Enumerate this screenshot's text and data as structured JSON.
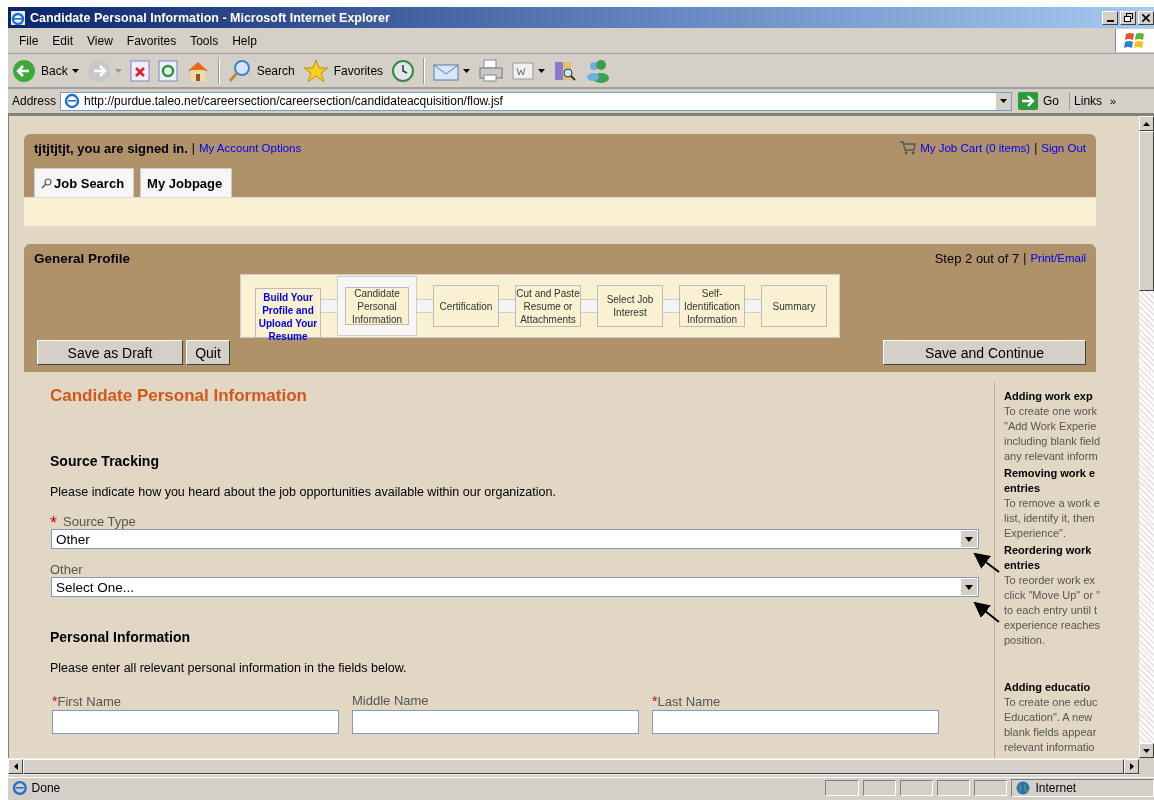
{
  "window": {
    "title": "Candidate Personal Information - Microsoft Internet Explorer"
  },
  "menu": [
    "File",
    "Edit",
    "View",
    "Favorites",
    "Tools",
    "Help"
  ],
  "toolbar": {
    "back": "Back",
    "search": "Search",
    "favorites": "Favorites"
  },
  "address": {
    "label": "Address",
    "url": "http://purdue.taleo.net/careersection/careersection/candidateacquisition/flow.jsf",
    "go": "Go",
    "links": "Links",
    "more": "»"
  },
  "header": {
    "user": "tjtjtjtjt, you are signed in.",
    "separator": "|",
    "account_link": "My Account Options",
    "cart_link": "My Job Cart (0 items)",
    "separator_2": "|",
    "sign_out": "Sign Out",
    "tabs": [
      {
        "label": "Job Search",
        "has_icon": true
      },
      {
        "label": "My Jobpage",
        "has_icon": false
      }
    ]
  },
  "profile": {
    "title": "General Profile",
    "step": "Step 2 out of 7",
    "separator": "|",
    "print_link": "Print/Email",
    "steps": [
      {
        "label": "Build Your Profile and Upload Your Resume",
        "completed": true,
        "selected": false
      },
      {
        "label": "Candidate Personal Information",
        "completed": false,
        "selected": true
      },
      {
        "label": "Certification",
        "completed": false,
        "selected": false
      },
      {
        "label": "Cut and Paste Resume or Attachments",
        "completed": false,
        "selected": false
      },
      {
        "label": "Select Job Interest",
        "completed": false,
        "selected": false
      },
      {
        "label": "Self-Identification Information",
        "completed": false,
        "selected": false
      },
      {
        "label": "Summary",
        "completed": false,
        "selected": false
      }
    ],
    "buttons_left": [
      "Save as Draft",
      "Quit"
    ],
    "button_right": "Save and Continue"
  },
  "form": {
    "title": "Candidate Personal Information",
    "source_heading": "Source Tracking",
    "source_text": "Please indicate how you heard about the job opportunities available within our organization.",
    "selects": [
      {
        "marker": "*",
        "label": "Source Type",
        "value": "Other"
      },
      {
        "label": "Other",
        "value": "Select One..."
      }
    ],
    "personal_heading": "Personal Information",
    "personal_text": "Please enter all relevant personal information in the fields below.",
    "name_fields": [
      {
        "marker": "*",
        "label": "First Name"
      },
      {
        "label": "Middle Name"
      },
      {
        "marker": "*",
        "label": "Last Name"
      }
    ]
  },
  "help": [
    {
      "heading": [
        "Adding work exp"
      ],
      "lines": [
        "To create one work",
        "\"Add Work Experie",
        "including blank field",
        "any relevant inform"
      ]
    },
    {
      "heading": [
        "Removing work e",
        "entries"
      ],
      "lines": [
        "To remove a work e",
        "list, identify it, then",
        "Experience\"."
      ]
    },
    {
      "heading": [
        "Reordering work",
        "entries"
      ],
      "lines": [
        "To reorder work ex",
        "click \"Move Up\" or \"",
        "to each entry until t",
        "experience reaches",
        "position."
      ]
    },
    {
      "heading": [
        "Adding educatio"
      ],
      "lines": [
        "To create one educ",
        "Education\". A new",
        "blank fields appear",
        "relevant informatio"
      ]
    }
  ],
  "status_bar": {
    "text": "Done",
    "zone": "Internet"
  }
}
